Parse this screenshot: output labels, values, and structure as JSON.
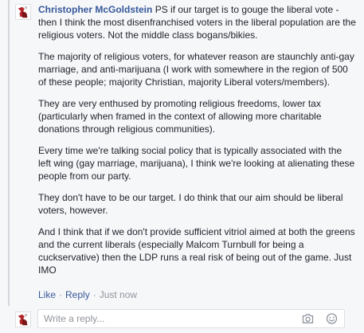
{
  "comment": {
    "author": "Christopher McGoldstein",
    "paragraphs": [
      "PS if our target is to gouge the liberal vote - then I think the most disenfranchised voters in the liberal population are the religious voters. Not the middle class bogans/bikies.",
      "The majority of religious voters, for whatever reason are staunchly anti-gay marriage, and anti-marijuana (I work with somewhere in the region of 500 of these people; majority Christian, majority Liberal voters/members).",
      "They are very enthused by promoting religious freedoms, lower tax (particularly when framed in the context of allowing more charitable donations through religious communities).",
      "Every time we're talking social policy that is typically associated with the left wing (gay marriage, marijuana), I think we're looking at alienating these people from our party.",
      "They don't have to be our target. I do think that our aim should be liberal voters, however.",
      "And I think that if we don't provide sufficient vitriol aimed at both the greens and the current liberals (especially Malcom Turnbull for being a cuckservative) then the LDP runs a real risk of being out of the game. Just IMO"
    ]
  },
  "actions": {
    "like": "Like",
    "sep1": "·",
    "reply": "Reply",
    "sep2": "·",
    "timestamp": "Just now"
  },
  "reply_box": {
    "placeholder": "Write a reply...",
    "value": ""
  },
  "icons": {
    "camera": "camera-icon",
    "emoji": "emoji-icon"
  },
  "colors": {
    "link": "#365899",
    "meta": "#90949c",
    "background": "#f6f7f9"
  }
}
